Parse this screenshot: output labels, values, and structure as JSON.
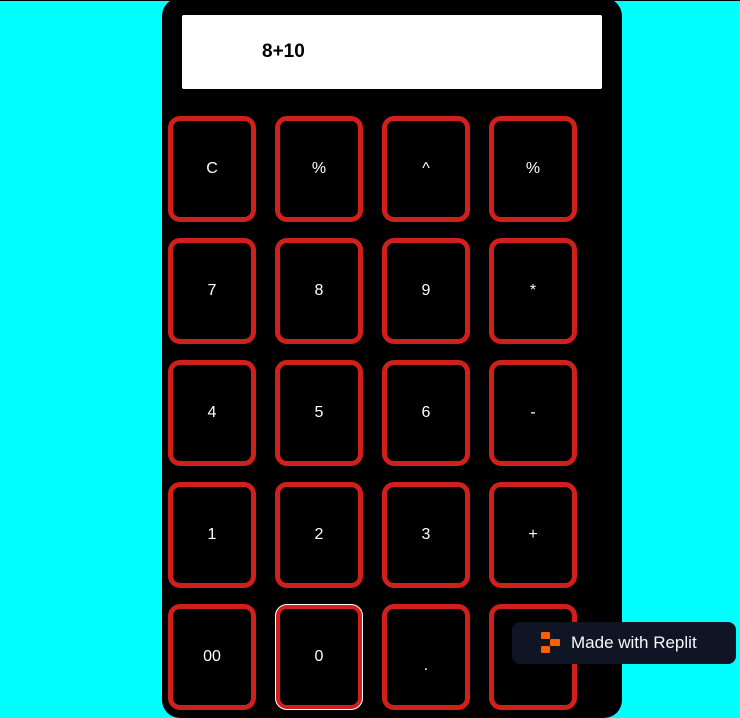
{
  "display": {
    "expression": "8+10"
  },
  "keys": [
    [
      "C",
      "%",
      "^",
      "%"
    ],
    [
      "7",
      "8",
      "9",
      "*"
    ],
    [
      "4",
      "5",
      "6",
      "-"
    ],
    [
      "1",
      "2",
      "3",
      "+"
    ],
    [
      "00",
      "0",
      ".",
      ""
    ]
  ],
  "badge": {
    "label": "Made with Replit",
    "icon": "replit-logo-icon"
  },
  "colors": {
    "background": "#00ffff",
    "calculator_body": "#000000",
    "key_border": "#d0201c",
    "badge_background": "#0f1524",
    "replit_orange": "#f26207"
  }
}
